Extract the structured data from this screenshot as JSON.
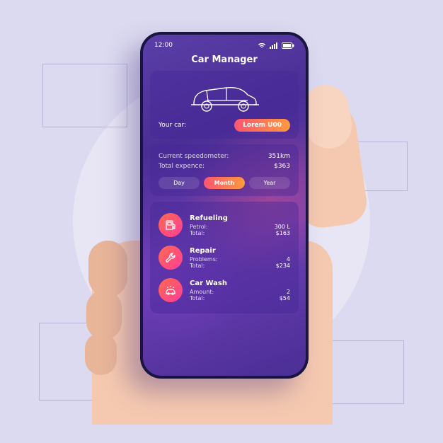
{
  "status": {
    "time": "12:00"
  },
  "app": {
    "title": "Car Manager"
  },
  "yourCar": {
    "label": "Your car:",
    "value": "Lorem U00"
  },
  "stats": {
    "speedometer": {
      "label": "Current speedometer:",
      "value": "351km"
    },
    "expense": {
      "label": "Total expence:",
      "value": "$363"
    }
  },
  "periods": {
    "day": "Day",
    "month": "Month",
    "year": "Year",
    "active": "month"
  },
  "categories": [
    {
      "icon": "fuel-icon",
      "title": "Refueling",
      "line1": {
        "label": "Petrol:",
        "value": "300 L"
      },
      "line2": {
        "label": "Total:",
        "value": "$163"
      }
    },
    {
      "icon": "wrench-icon",
      "title": "Repair",
      "line1": {
        "label": "Problems:",
        "value": "4"
      },
      "line2": {
        "label": "Total:",
        "value": "$234"
      }
    },
    {
      "icon": "carwash-icon",
      "title": "Car Wash",
      "line1": {
        "label": "Amount:",
        "value": "2"
      },
      "line2": {
        "label": "Total:",
        "value": "$54"
      }
    }
  ]
}
